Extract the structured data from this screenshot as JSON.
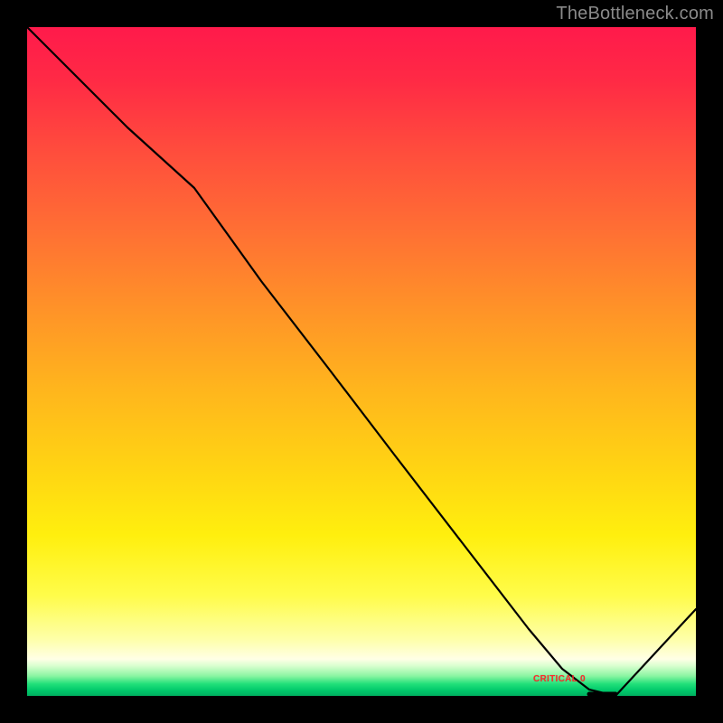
{
  "watermark": "TheBottleneck.com",
  "marker_label": "CRITICAL 0",
  "colors": {
    "background": "#000000",
    "watermark": "#8a8a8a",
    "marker": "#ff2a2a",
    "curve": "#000000"
  },
  "chart_data": {
    "type": "line",
    "title": "",
    "xlabel": "",
    "ylabel": "",
    "xlim": [
      0,
      100
    ],
    "ylim": [
      0,
      100
    ],
    "x": [
      0,
      5,
      15,
      25,
      35,
      45,
      55,
      65,
      75,
      80,
      84,
      88,
      100
    ],
    "y": [
      100,
      95,
      85,
      76,
      62,
      49,
      36,
      23,
      10,
      4,
      1,
      0,
      13
    ],
    "min_point": {
      "x": 86,
      "y": 0
    },
    "annotations": [
      {
        "text": "CRITICAL 0",
        "x": 79,
        "y": 1
      }
    ],
    "background_gradient": {
      "top": "#ff1a4b",
      "mid": "#ffd413",
      "low": "#feffa8",
      "bottom": "#00b060"
    }
  }
}
